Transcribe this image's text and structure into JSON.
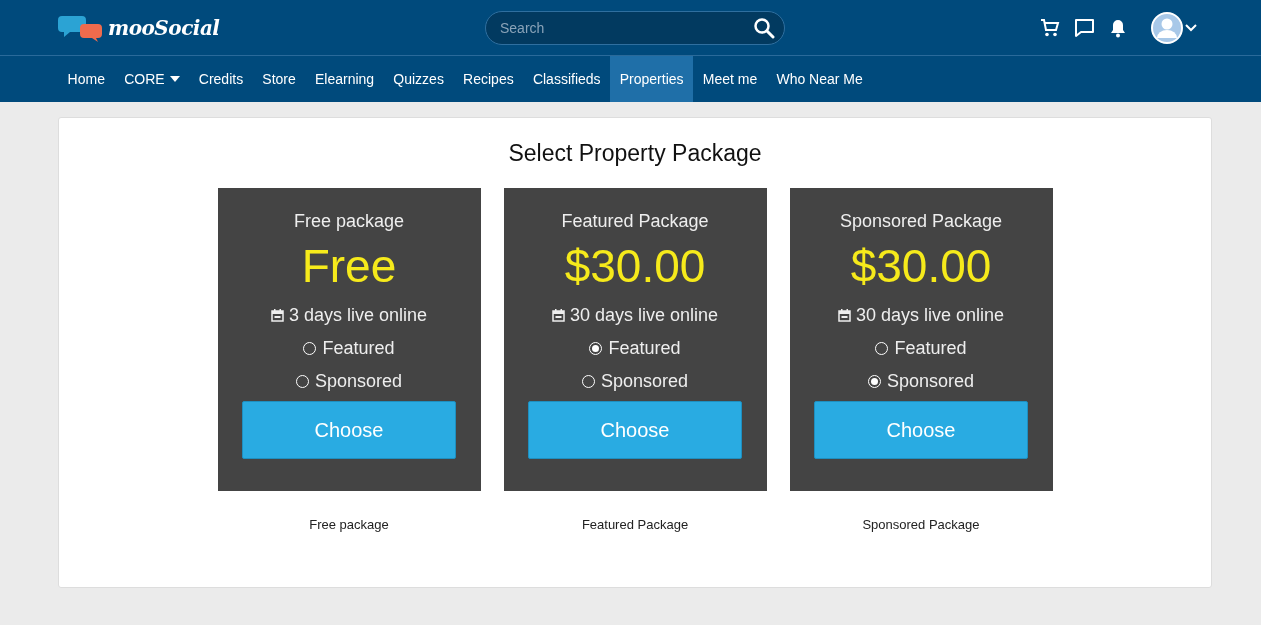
{
  "header": {
    "logo": "mooSocial",
    "search": {
      "placeholder": "Search"
    }
  },
  "nav": [
    {
      "label": "Home",
      "selected": false,
      "dropdown": false
    },
    {
      "label": "CORE",
      "selected": false,
      "dropdown": true
    },
    {
      "label": "Credits",
      "selected": false,
      "dropdown": false
    },
    {
      "label": "Store",
      "selected": false,
      "dropdown": false
    },
    {
      "label": "Elearning",
      "selected": false,
      "dropdown": false
    },
    {
      "label": "Quizzes",
      "selected": false,
      "dropdown": false
    },
    {
      "label": "Recipes",
      "selected": false,
      "dropdown": false
    },
    {
      "label": "Classifieds",
      "selected": false,
      "dropdown": false
    },
    {
      "label": "Properties",
      "selected": true,
      "dropdown": false
    },
    {
      "label": "Meet me",
      "selected": false,
      "dropdown": false
    },
    {
      "label": "Who Near Me",
      "selected": false,
      "dropdown": false
    }
  ],
  "page": {
    "title": "Select Property Package",
    "packages": [
      {
        "name": "Free package",
        "price": "Free",
        "duration": "3 days live online",
        "options": [
          {
            "label": "Featured",
            "checked": false
          },
          {
            "label": "Sponsored",
            "checked": false
          }
        ],
        "button": "Choose",
        "caption": "Free package"
      },
      {
        "name": "Featured Package",
        "price": "$30.00",
        "duration": "30 days live online",
        "options": [
          {
            "label": "Featured",
            "checked": true
          },
          {
            "label": "Sponsored",
            "checked": false
          }
        ],
        "button": "Choose",
        "caption": "Featured Package"
      },
      {
        "name": "Sponsored Package",
        "price": "$30.00",
        "duration": "30 days live online",
        "options": [
          {
            "label": "Featured",
            "checked": false
          },
          {
            "label": "Sponsored",
            "checked": true
          }
        ],
        "button": "Choose",
        "caption": "Sponsored Package"
      }
    ]
  }
}
